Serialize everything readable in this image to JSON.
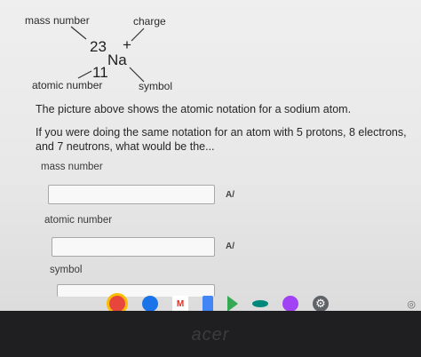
{
  "diagram": {
    "mass_number_label": "mass number",
    "charge_label": "charge",
    "atomic_number_label": "atomic number",
    "symbol_label": "symbol",
    "mass_value": "23",
    "charge_value": "+",
    "element_symbol": "Na",
    "atomic_value": "11"
  },
  "question": {
    "intro": "The picture above shows the atomic notation for a sodium atom.",
    "prompt": "If you were doing the same notation for an atom with 5 protons, 8 electrons, and 7 neutrons, what would be the..."
  },
  "fields": [
    {
      "label": "mass number",
      "value": ""
    },
    {
      "label": "atomic number",
      "value": ""
    },
    {
      "label": "symbol",
      "value": ""
    }
  ],
  "spellcheck_glyph": "A/",
  "taskbar": {
    "apps": [
      {
        "name": "chrome-icon",
        "glyph": "",
        "color": "#e8453c"
      },
      {
        "name": "files-icon",
        "glyph": "",
        "color": "#1a73e8"
      },
      {
        "name": "gmail-icon",
        "glyph": "M",
        "color": "#ffffff"
      },
      {
        "name": "docs-icon",
        "glyph": "",
        "color": "#4285f4"
      },
      {
        "name": "play-icon",
        "glyph": "",
        "color": "#34a853"
      },
      {
        "name": "meet-icon",
        "glyph": "",
        "color": "#00897b"
      },
      {
        "name": "app-icon",
        "glyph": "",
        "color": "#a142f4"
      },
      {
        "name": "settings-icon",
        "glyph": "⚙",
        "color": "#5f6368"
      }
    ]
  },
  "brand": "acer"
}
